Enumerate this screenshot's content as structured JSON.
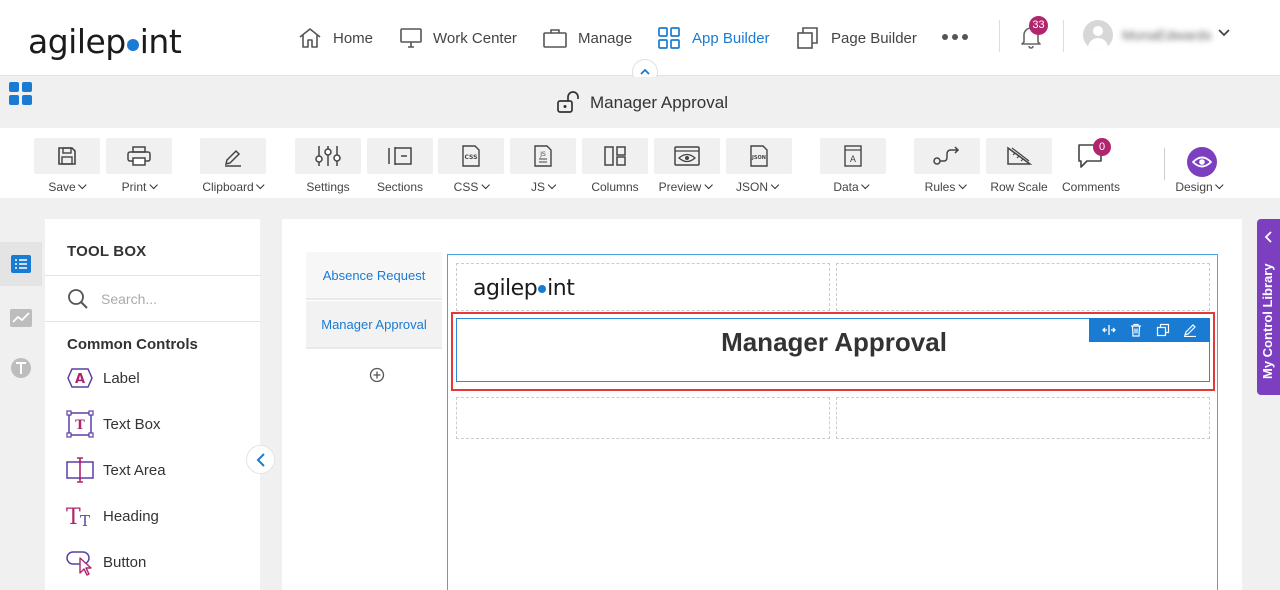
{
  "header": {
    "logo_before": "agilep",
    "logo_after": "int",
    "nav": [
      {
        "label": "Home",
        "icon": "home-icon"
      },
      {
        "label": "Work Center",
        "icon": "monitor-icon"
      },
      {
        "label": "Manage",
        "icon": "briefcase-icon"
      },
      {
        "label": "App Builder",
        "icon": "grid-icon",
        "active": true
      },
      {
        "label": "Page Builder",
        "icon": "pages-icon"
      }
    ],
    "notification_count": "33",
    "user_name": "MonaEdwards"
  },
  "titlebar": {
    "title": "Manager Approval"
  },
  "toolbar": {
    "items": [
      {
        "label": "Save",
        "dropdown": true,
        "icon": "save-icon"
      },
      {
        "label": "Print",
        "dropdown": true,
        "icon": "print-icon"
      },
      {
        "label": "Clipboard",
        "dropdown": true,
        "icon": "clipboard-icon"
      },
      {
        "label": "Settings",
        "dropdown": false,
        "icon": "settings-sliders-icon"
      },
      {
        "label": "Sections",
        "dropdown": false,
        "icon": "sections-icon"
      },
      {
        "label": "CSS",
        "dropdown": true,
        "icon": "css-icon"
      },
      {
        "label": "JS",
        "dropdown": true,
        "icon": "js-icon"
      },
      {
        "label": "Columns",
        "dropdown": false,
        "icon": "columns-icon"
      },
      {
        "label": "Preview",
        "dropdown": true,
        "icon": "preview-icon"
      },
      {
        "label": "JSON",
        "dropdown": true,
        "icon": "json-icon"
      },
      {
        "label": "Data",
        "dropdown": true,
        "icon": "data-icon"
      },
      {
        "label": "Rules",
        "dropdown": true,
        "icon": "rules-icon"
      },
      {
        "label": "Row Scale",
        "dropdown": false,
        "icon": "row-scale-icon"
      },
      {
        "label": "Comments",
        "dropdown": false,
        "icon": "comments-icon"
      },
      {
        "label": "Design",
        "dropdown": true,
        "icon": "design-eye-icon"
      }
    ],
    "comments_count": "0"
  },
  "toolbox": {
    "title": "TOOL BOX",
    "search_placeholder": "Search...",
    "section": "Common Controls",
    "tools": [
      {
        "label": "Label",
        "icon": "label-icon"
      },
      {
        "label": "Text Box",
        "icon": "text-box-icon"
      },
      {
        "label": "Text Area",
        "icon": "text-area-icon"
      },
      {
        "label": "Heading",
        "icon": "heading-icon"
      },
      {
        "label": "Button",
        "icon": "button-icon"
      }
    ]
  },
  "canvas": {
    "form_tabs": [
      "Absence Request",
      "Manager Approval"
    ],
    "active_tab": "Manager Approval",
    "form_logo_before": "agilep",
    "form_logo_after": "int",
    "heading": "Manager Approval"
  },
  "right_panel": {
    "label": "My Control Library"
  },
  "colors": {
    "accent": "#1a7bd2",
    "purple": "#7b3fc0",
    "badge": "#b0256d",
    "selection_red": "#e5383b"
  }
}
